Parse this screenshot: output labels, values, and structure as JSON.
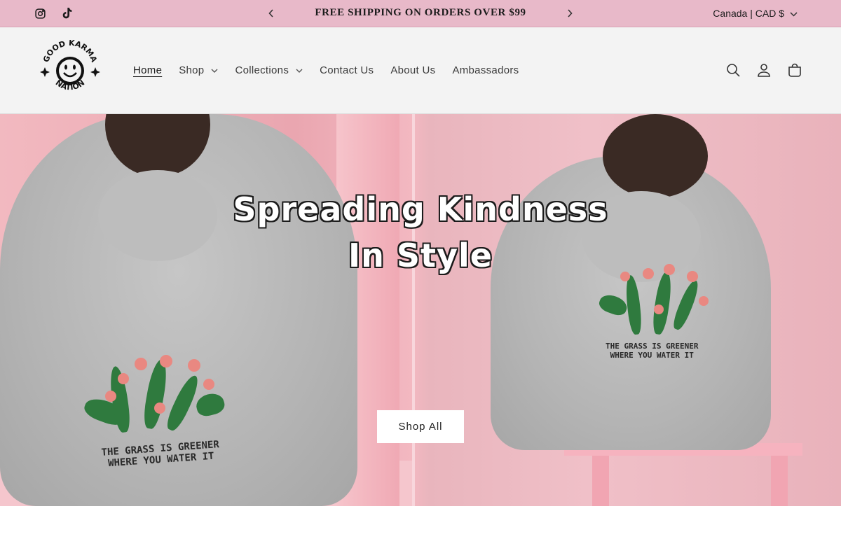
{
  "announcement": {
    "message": "FREE SHIPPING ON ORDERS OVER $99",
    "locale": "Canada | CAD $",
    "social": [
      "instagram-icon",
      "tiktok-icon"
    ]
  },
  "header": {
    "logo_alt": "Good Karma Nation",
    "nav": [
      {
        "label": "Home",
        "active": true,
        "dropdown": false
      },
      {
        "label": "Shop",
        "active": false,
        "dropdown": true
      },
      {
        "label": "Collections",
        "active": false,
        "dropdown": true
      },
      {
        "label": "Contact Us",
        "active": false,
        "dropdown": false
      },
      {
        "label": "About Us",
        "active": false,
        "dropdown": false
      },
      {
        "label": "Ambassadors",
        "active": false,
        "dropdown": false
      }
    ],
    "icons": [
      "search-icon",
      "account-icon",
      "cart-icon"
    ]
  },
  "hero": {
    "headline_line1": "Spreading Kindness",
    "headline_line2": "In Style",
    "cta_label": "Shop All",
    "print_text_line1": "THE GRASS IS GREENER",
    "print_text_line2": "WHERE YOU WATER IT"
  },
  "colors": {
    "announcement_bg": "#e8b9c9",
    "header_bg": "#f3f3f3",
    "hero_pink": "#eaa6b0",
    "button_bg": "#ffffff"
  }
}
